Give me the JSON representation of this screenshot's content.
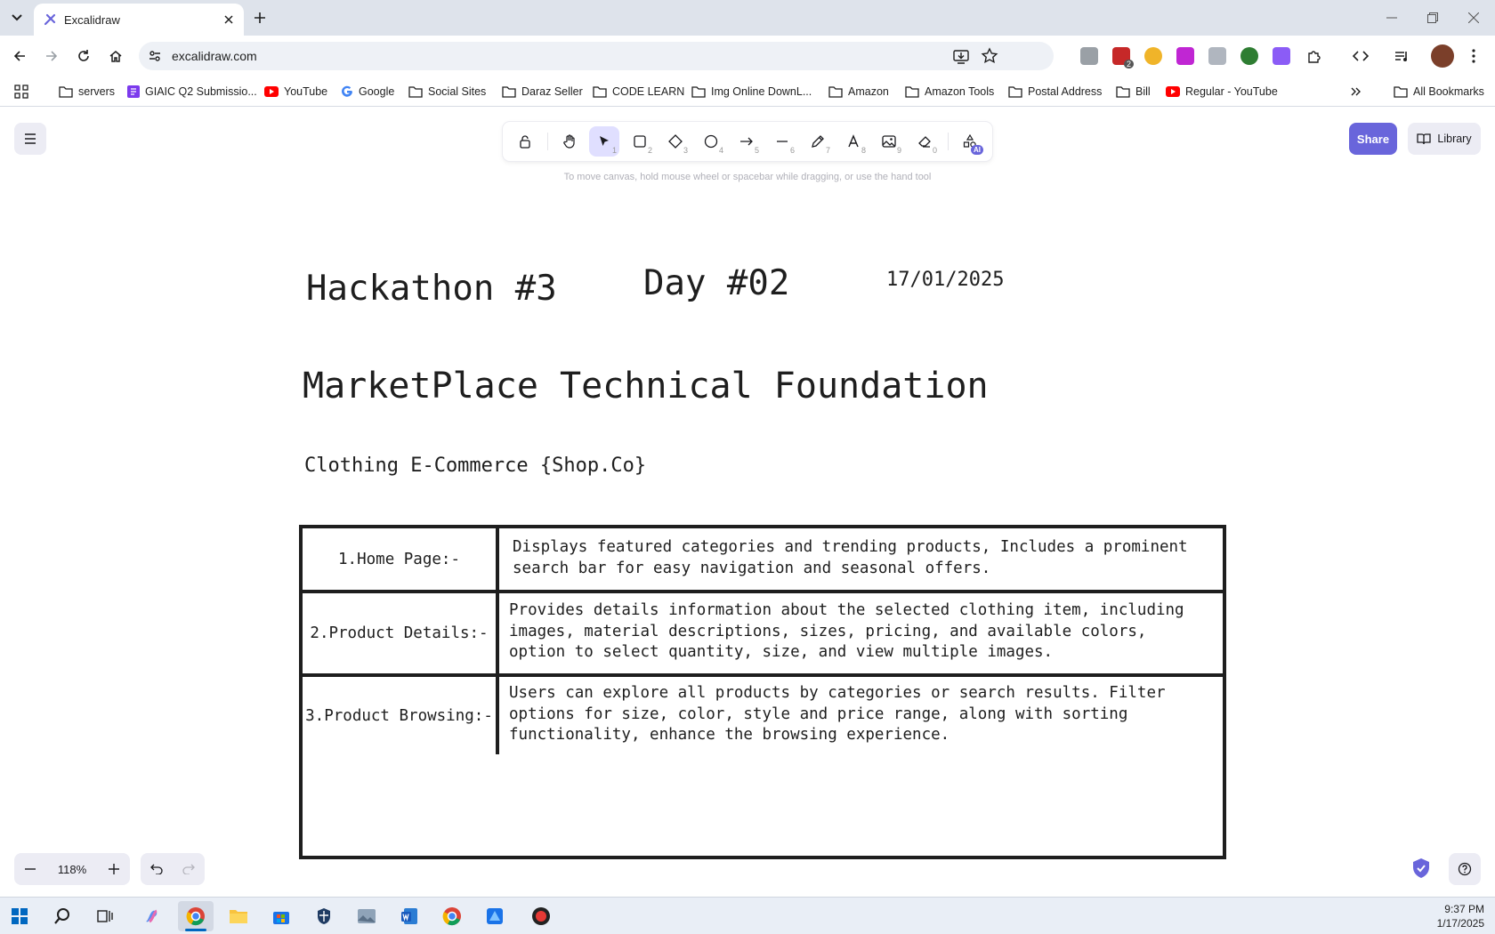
{
  "browser": {
    "tab_title": "Excalidraw",
    "url": "excalidraw.com",
    "bookmarks": [
      {
        "label": "servers",
        "icon": "folder-icon"
      },
      {
        "label": "GIAIC Q2 Submissio...",
        "icon": "form-icon"
      },
      {
        "label": "YouTube",
        "icon": "youtube-icon"
      },
      {
        "label": "Google",
        "icon": "google-icon"
      },
      {
        "label": "Social Sites",
        "icon": "folder-icon"
      },
      {
        "label": "Daraz Seller",
        "icon": "folder-icon"
      },
      {
        "label": "CODE LEARN",
        "icon": "folder-icon"
      },
      {
        "label": "Img Online DownL...",
        "icon": "folder-icon"
      },
      {
        "label": "Amazon",
        "icon": "folder-icon"
      },
      {
        "label": "Amazon Tools",
        "icon": "folder-icon"
      },
      {
        "label": "Postal Address",
        "icon": "folder-icon"
      },
      {
        "label": "Bill",
        "icon": "folder-icon"
      },
      {
        "label": "Regular - YouTube",
        "icon": "youtube-icon"
      }
    ],
    "all_bookmarks": "All Bookmarks",
    "extension_badge": "2"
  },
  "app": {
    "hint": "To move canvas, hold mouse wheel or spacebar while dragging, or use the hand tool",
    "tools": [
      {
        "name": "lock",
        "num": ""
      },
      {
        "name": "hand",
        "num": ""
      },
      {
        "name": "selection",
        "num": "1"
      },
      {
        "name": "rectangle",
        "num": "2"
      },
      {
        "name": "diamond",
        "num": "3"
      },
      {
        "name": "ellipse",
        "num": "4"
      },
      {
        "name": "arrow",
        "num": "5"
      },
      {
        "name": "line",
        "num": "6"
      },
      {
        "name": "draw",
        "num": "7"
      },
      {
        "name": "text",
        "num": "8"
      },
      {
        "name": "image",
        "num": "9"
      },
      {
        "name": "eraser",
        "num": "0"
      },
      {
        "name": "more-tools",
        "num": ""
      }
    ],
    "ai_badge": "AI",
    "share_label": "Share",
    "library_label": "Library",
    "zoom": "118%"
  },
  "canvas": {
    "hackathon": "Hackathon #3",
    "day": "Day #02",
    "date": "17/01/2025",
    "title": "MarketPlace Technical Foundation",
    "subtitle": "Clothing E-Commerce {Shop.Co}",
    "features": [
      {
        "label": "1.Home Page:-",
        "desc": "Displays featured categories and trending products, Includes a prominent\nsearch bar for easy navigation and seasonal offers."
      },
      {
        "label": "2.Product Details:-",
        "desc": "Provides details information about the selected clothing item, including\nimages, material descriptions, sizes, pricing, and available colors,\noption to select quantity, size, and view multiple images."
      },
      {
        "label": "3.Product Browsing:-",
        "desc": "Users can explore all products by categories or search results. Filter\noptions for size, color, style and price range, along with sorting\nfunctionality, enhance the browsing experience."
      }
    ]
  },
  "taskbar": {
    "time": "9:37 PM",
    "date": "1/17/2025"
  },
  "colors": {
    "accent": "#6965db",
    "tool_selected": "#e0dfff"
  }
}
